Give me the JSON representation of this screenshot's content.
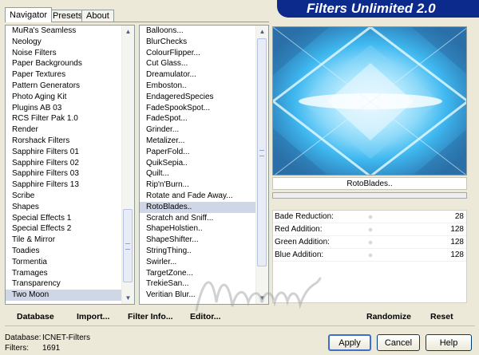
{
  "tabs": [
    "Navigator",
    "Presets",
    "About"
  ],
  "app_title": "Filters Unlimited 2.0",
  "categories": [
    "MuRa's Seamless",
    "Neology",
    "Noise Filters",
    "Paper Backgrounds",
    "Paper Textures",
    "Pattern Generators",
    "Photo Aging Kit",
    "Plugins AB 03",
    "RCS Filter Pak 1.0",
    "Render",
    "Rorshack Filters",
    "Sapphire Filters 01",
    "Sapphire Filters 02",
    "Sapphire Filters 03",
    "Sapphire Filters 13",
    "Scribe",
    "Shapes",
    "Special Effects 1",
    "Special Effects 2",
    "Tile & Mirror",
    "Toadies",
    "Tormentia",
    "Tramages",
    "Transparency",
    "Two Moon"
  ],
  "selected_category": "Two Moon",
  "filters": [
    "Balloons...",
    "BlurChecks",
    "ColourFlipper...",
    "Cut Glass...",
    "Dreamulator...",
    "Emboston..",
    "EndageredSpecies",
    "FadeSpookSpot...",
    "FadeSpot...",
    "Grinder...",
    "Metalizer...",
    "PaperFold...",
    "QuikSepia..",
    "Quilt...",
    "Rip'n'Burn...",
    "Rotate and Fade Away...",
    "RotoBlades..",
    "Scratch and Sniff...",
    "ShapeHolstien..",
    "ShapeShifter...",
    "StringThing..",
    "Swirler...",
    "TargetZone...",
    "TrekieSan...",
    "Veritian Blur..."
  ],
  "selected_filter": "RotoBlades..",
  "filter_name": "RotoBlades..",
  "params": [
    {
      "label": "Bade Reduction:",
      "value": "28"
    },
    {
      "label": "Red Addition:",
      "value": "128"
    },
    {
      "label": "Green Addition:",
      "value": "128"
    },
    {
      "label": "Blue Addition:",
      "value": "128"
    }
  ],
  "links": {
    "database": "Database",
    "import": "Import...",
    "filter_info": "Filter Info...",
    "editor": "Editor...",
    "randomize": "Randomize",
    "reset": "Reset"
  },
  "info": {
    "database_label": "Database:",
    "database_value": "ICNET-Filters",
    "filters_label": "Filters:",
    "filters_value": "1691"
  },
  "buttons": {
    "apply": "Apply",
    "cancel": "Cancel",
    "help": "Help"
  },
  "icons": {
    "scroll_up": "arrow-up-icon",
    "scroll_down": "arrow-down-icon",
    "grip": "scroll-grip-icon"
  },
  "colors": {
    "banner": "#0b2a8c",
    "preview_light": "#e8fbff",
    "preview_mid": "#3fb8f0",
    "preview_dark": "#2a6fa8"
  }
}
